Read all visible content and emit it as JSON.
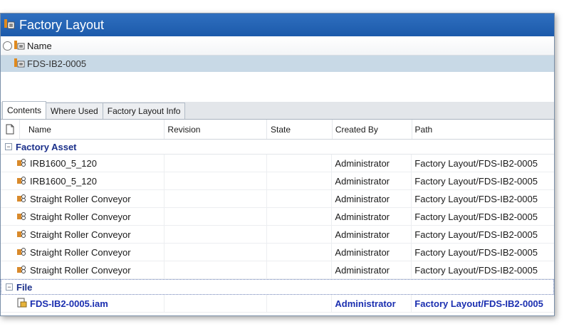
{
  "window": {
    "title": "Factory Layout"
  },
  "top_list": {
    "header_label": "Name",
    "selected_item": "FDS-IB2-0005"
  },
  "tabs": [
    {
      "label": "Contents",
      "active": true
    },
    {
      "label": "Where Used",
      "active": false
    },
    {
      "label": "Factory Layout Info",
      "active": false
    }
  ],
  "grid": {
    "columns": {
      "name": "Name",
      "revision": "Revision",
      "state": "State",
      "created_by": "Created By",
      "path": "Path"
    },
    "groups": [
      {
        "label": "Factory Asset",
        "rows": [
          {
            "name": "IRB1600_5_120",
            "revision": "",
            "state": "",
            "created_by": "Administrator",
            "path": "Factory Layout/FDS-IB2-0005"
          },
          {
            "name": "IRB1600_5_120",
            "revision": "",
            "state": "",
            "created_by": "Administrator",
            "path": "Factory Layout/FDS-IB2-0005"
          },
          {
            "name": "Straight Roller Conveyor",
            "revision": "",
            "state": "",
            "created_by": "Administrator",
            "path": "Factory Layout/FDS-IB2-0005"
          },
          {
            "name": "Straight Roller Conveyor",
            "revision": "",
            "state": "",
            "created_by": "Administrator",
            "path": "Factory Layout/FDS-IB2-0005"
          },
          {
            "name": "Straight Roller Conveyor",
            "revision": "",
            "state": "",
            "created_by": "Administrator",
            "path": "Factory Layout/FDS-IB2-0005"
          },
          {
            "name": "Straight Roller Conveyor",
            "revision": "",
            "state": "",
            "created_by": "Administrator",
            "path": "Factory Layout/FDS-IB2-0005"
          },
          {
            "name": "Straight Roller Conveyor",
            "revision": "",
            "state": "",
            "created_by": "Administrator",
            "path": "Factory Layout/FDS-IB2-0005"
          }
        ]
      },
      {
        "label": "File",
        "rows": [
          {
            "name": "FDS-IB2-0005.iam",
            "revision": "",
            "state": "",
            "created_by": "Administrator",
            "path": "Factory Layout/FDS-IB2-0005"
          }
        ]
      }
    ]
  },
  "icons": {
    "factory_layout": "factory-layout-icon",
    "asset": "factory-asset-icon",
    "file": "assembly-file-icon",
    "document": "document-icon"
  },
  "colors": {
    "titlebar": "#1c5aab",
    "selection": "#c8d9e6",
    "group_text": "#1a2f8a",
    "file_row_text": "#1b2fb0"
  }
}
